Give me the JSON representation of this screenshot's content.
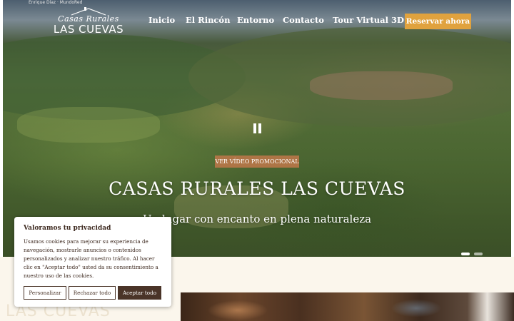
{
  "hero": {
    "photo_credit": "Enrique Díaz · MundoRed",
    "title": "CASAS RURALES LAS CUEVAS",
    "subtitle": "Un lugar con encanto en plena naturaleza",
    "video_button": "VER VÍDEO PROMOCIONAL",
    "pause_icon": "pause-icon"
  },
  "logo": {
    "script_text": "Casas Rurales",
    "main_text": "LAS CUEVAS"
  },
  "nav": {
    "items": [
      {
        "label": "Inicio"
      },
      {
        "label": "El Rincón"
      },
      {
        "label": "Entorno"
      },
      {
        "label": "Contacto"
      },
      {
        "label": "Tour Virtual 3D"
      }
    ],
    "reserve_label": "Reservar ahora"
  },
  "section": {
    "watermark": "LAS CUEVAS"
  },
  "cookie_banner": {
    "title": "Valoramos tu privacidad",
    "text": "Usamos cookies para mejorar su experiencia de navegación, mostrarle anuncios o contenidos personalizados y analizar nuestro tráfico. Al hacer clic en \"Aceptar todo\" usted da su consentimiento a nuestro uso de las cookies.",
    "customize_label": "Personalizar",
    "reject_label": "Rechazar todo",
    "accept_label": "Aceptar todo"
  },
  "colors": {
    "accent": "#e0a23e",
    "video_button": "#b67648",
    "cookie_dark": "#4a3428",
    "cream": "#fbf6ec"
  }
}
